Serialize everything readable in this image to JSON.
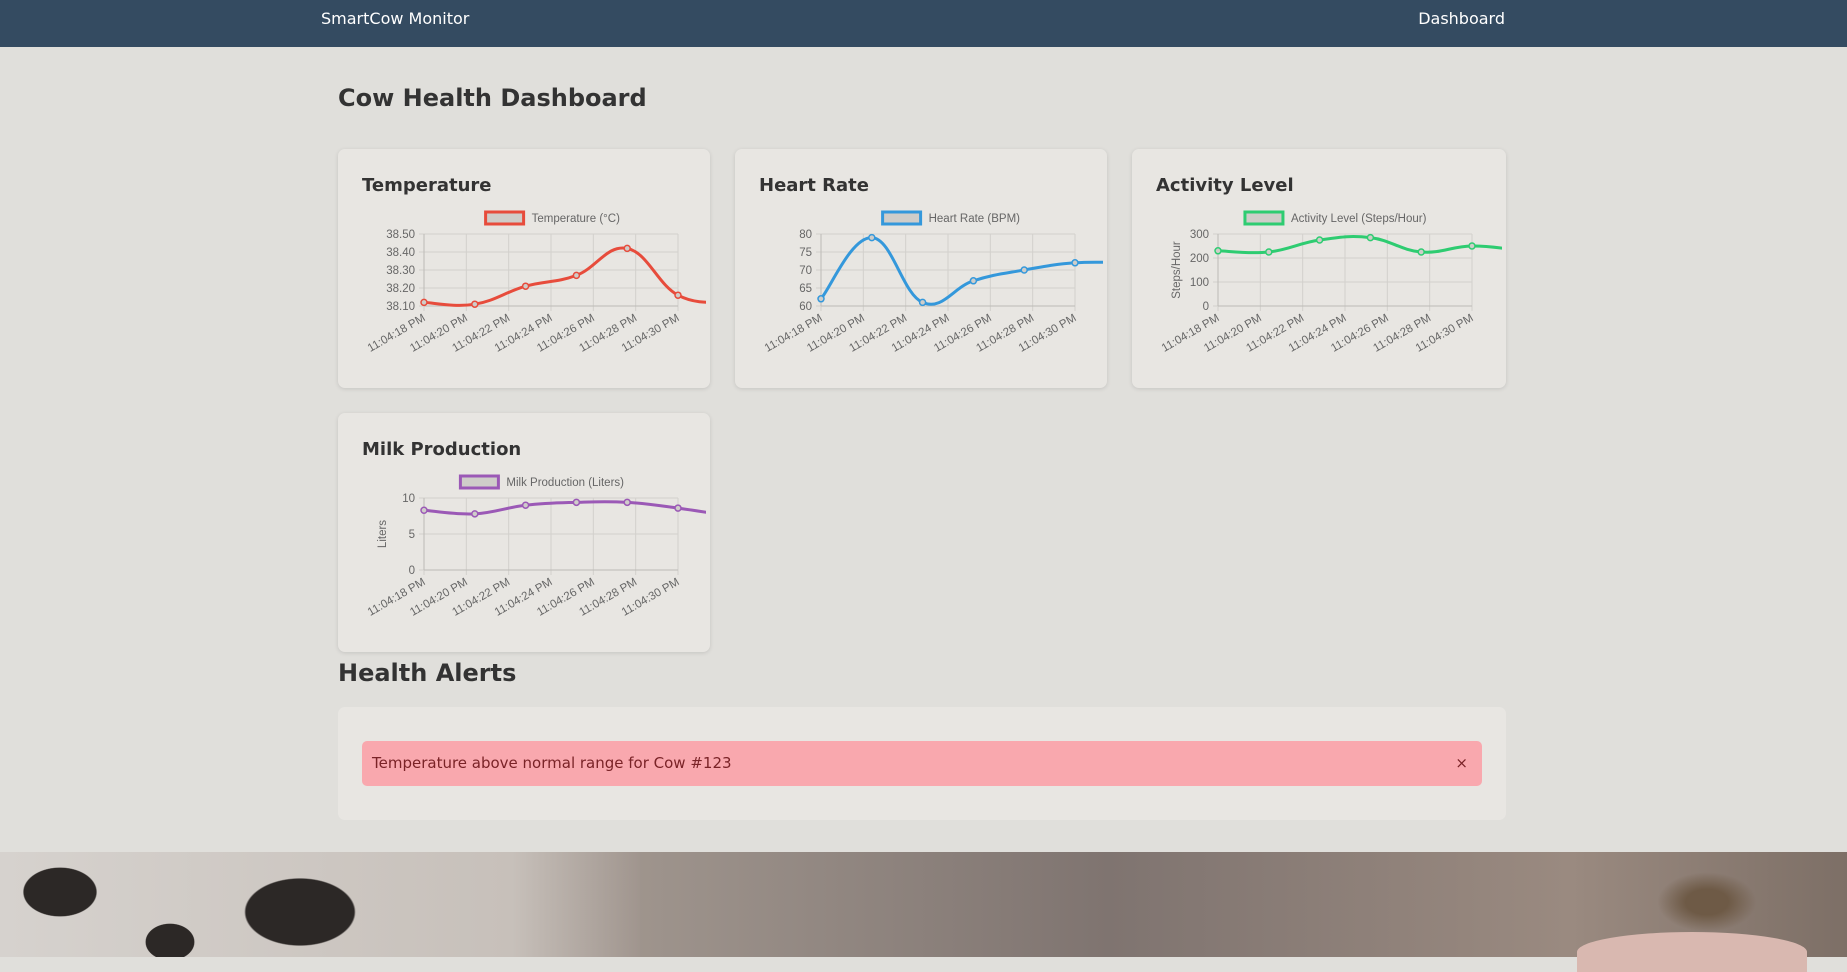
{
  "nav": {
    "brand": "SmartCow Monitor",
    "link": "Dashboard"
  },
  "page_title": "Cow Health Dashboard",
  "chart_data": [
    {
      "type": "line",
      "title": "Temperature",
      "categories": [
        "11:04:18 PM",
        "11:04:20 PM",
        "11:04:22 PM",
        "11:04:24 PM",
        "11:04:26 PM",
        "11:04:28 PM",
        "11:04:30 PM"
      ],
      "series": [
        {
          "name": "Temperature (°C)",
          "color": "#e74c3c",
          "x": [
            0,
            1.2,
            2.4,
            3.6,
            4.8,
            6.0,
            7.2
          ],
          "values": [
            38.12,
            38.11,
            38.21,
            38.27,
            38.42,
            38.16,
            38.12
          ]
        }
      ],
      "xlim": [
        0,
        6
      ],
      "ylim": [
        38.1,
        38.5
      ],
      "yticks": [
        "38.50",
        "38.40",
        "38.30",
        "38.20",
        "38.10"
      ],
      "ylabel": ""
    },
    {
      "type": "line",
      "title": "Heart Rate",
      "categories": [
        "11:04:18 PM",
        "11:04:20 PM",
        "11:04:22 PM",
        "11:04:24 PM",
        "11:04:26 PM",
        "11:04:28 PM",
        "11:04:30 PM"
      ],
      "series": [
        {
          "name": "Heart Rate (BPM)",
          "color": "#3498db",
          "x": [
            0,
            1.2,
            2.4,
            3.6,
            4.8,
            6.0,
            7.2
          ],
          "values": [
            62,
            79,
            61,
            67,
            70,
            72,
            72
          ]
        }
      ],
      "xlim": [
        0,
        6
      ],
      "ylim": [
        60,
        80
      ],
      "yticks": [
        "80",
        "75",
        "70",
        "65",
        "60"
      ],
      "ylabel": ""
    },
    {
      "type": "line",
      "title": "Activity Level",
      "categories": [
        "11:04:18 PM",
        "11:04:20 PM",
        "11:04:22 PM",
        "11:04:24 PM",
        "11:04:26 PM",
        "11:04:28 PM",
        "11:04:30 PM"
      ],
      "series": [
        {
          "name": "Activity Level (Steps/Hour)",
          "color": "#2ecc71",
          "x": [
            0,
            1.2,
            2.4,
            3.6,
            4.8,
            6.0,
            7.2
          ],
          "values": [
            230,
            225,
            275,
            285,
            225,
            250,
            230
          ]
        }
      ],
      "xlim": [
        0,
        6
      ],
      "ylim": [
        0,
        300
      ],
      "yticks": [
        "300",
        "200",
        "100",
        "0"
      ],
      "ylabel": "Steps/Hour"
    },
    {
      "type": "line",
      "title": "Milk Production",
      "categories": [
        "11:04:18 PM",
        "11:04:20 PM",
        "11:04:22 PM",
        "11:04:24 PM",
        "11:04:26 PM",
        "11:04:28 PM",
        "11:04:30 PM"
      ],
      "series": [
        {
          "name": "Milk Production (Liters)",
          "color": "#9b59b6",
          "x": [
            0,
            1.2,
            2.4,
            3.6,
            4.8,
            6.0,
            7.2
          ],
          "values": [
            8.3,
            7.8,
            9.0,
            9.4,
            9.4,
            8.6,
            7.5
          ]
        }
      ],
      "xlim": [
        0,
        6
      ],
      "ylim": [
        0,
        10
      ],
      "yticks": [
        "10",
        "5",
        "0"
      ],
      "ylabel": "Liters"
    }
  ],
  "alerts": {
    "title": "Health Alerts",
    "items": [
      {
        "text": "Temperature above normal range for Cow #123",
        "close": "×"
      }
    ]
  },
  "colors": {
    "navbar": "#344b61",
    "alert_bg": "#f9a8ae",
    "alert_text": "#7a2327"
  }
}
